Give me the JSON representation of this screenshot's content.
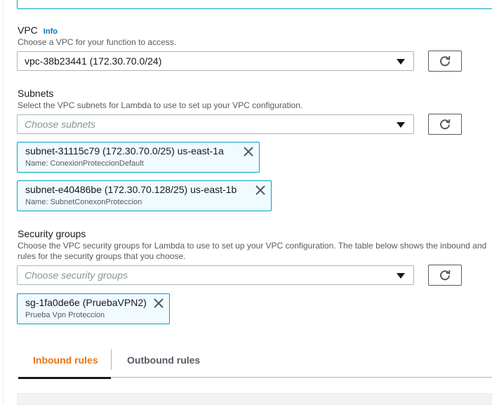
{
  "vpc": {
    "label": "VPC",
    "info": "Info",
    "description": "Choose a VPC for your function to access.",
    "selected": "vpc-38b23441 (172.30.70.0/24)"
  },
  "subnets": {
    "label": "Subnets",
    "description": "Select the VPC subnets for Lambda to use to set up your VPC configuration.",
    "placeholder": "Choose subnets",
    "tokens": [
      {
        "title": "subnet-31115c79 (172.30.70.0/25)  us-east-1a",
        "sub": "Name: ConexionProteccionDefault"
      },
      {
        "title": "subnet-e40486be (172.30.70.128/25)  us-east-1b",
        "sub": "Name: SubnetConexonProteccion"
      }
    ]
  },
  "security_groups": {
    "label": "Security groups",
    "description_line1": "Choose the VPC security groups for Lambda to use to set up your VPC configuration. The table below shows the inbound and",
    "description_line2": "rules for the security groups that you choose.",
    "placeholder": "Choose security groups",
    "tokens": [
      {
        "title": "sg-1fa0de6e (PruebaVPN2)",
        "sub": "Prueba Vpn Proteccion"
      }
    ]
  },
  "tabs": {
    "inbound": "Inbound rules",
    "outbound": "Outbound rules",
    "active": "inbound"
  },
  "colors": {
    "accent": "#ec7211",
    "token_border": "#00a1c9",
    "token_bg": "#f1faff"
  }
}
